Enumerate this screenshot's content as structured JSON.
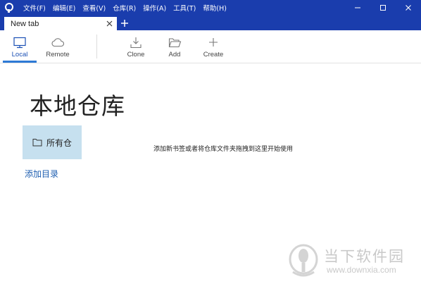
{
  "menu": {
    "items": [
      "文件(F)",
      "编辑(E)",
      "查看(V)",
      "仓库(R)",
      "操作(A)",
      "工具(T)",
      "帮助(H)"
    ]
  },
  "window_controls": {
    "minimize": "minimize-icon",
    "maximize": "maximize-icon",
    "close": "close-icon"
  },
  "tabs": [
    {
      "label": "New tab",
      "close_icon": "close-icon"
    }
  ],
  "tab_add_icon": "plus-icon",
  "toolbar": {
    "local": {
      "label": "Local",
      "icon": "monitor-icon",
      "active": true
    },
    "remote": {
      "label": "Remote",
      "icon": "cloud-icon"
    },
    "clone": {
      "label": "Clone",
      "icon": "download-icon"
    },
    "add": {
      "label": "Add",
      "icon": "folder-open-icon"
    },
    "create": {
      "label": "Create",
      "icon": "plus-icon"
    }
  },
  "main": {
    "title": "本地仓库",
    "folder": {
      "label": "所有仓",
      "icon": "folder-icon"
    },
    "add_directory_link": "添加目录",
    "empty_hint": "添加新书签或者将仓库文件夹拖拽到这里开始使用"
  },
  "watermark": {
    "name": "当下软件园",
    "url": "www.downxia.com"
  },
  "colors": {
    "titlebar": "#1a3dad",
    "accent": "#2d7ad6",
    "selected_item": "#c6e0ef",
    "link": "#1f5fb0"
  }
}
